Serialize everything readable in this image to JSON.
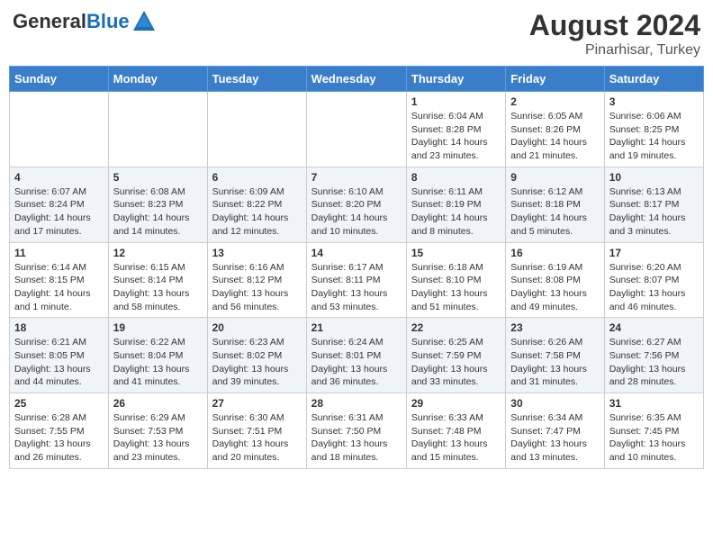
{
  "header": {
    "logo_general": "General",
    "logo_blue": "Blue",
    "month_year": "August 2024",
    "location": "Pinarhisar, Turkey"
  },
  "weekdays": [
    "Sunday",
    "Monday",
    "Tuesday",
    "Wednesday",
    "Thursday",
    "Friday",
    "Saturday"
  ],
  "weeks": [
    [
      {
        "day": "",
        "content": ""
      },
      {
        "day": "",
        "content": ""
      },
      {
        "day": "",
        "content": ""
      },
      {
        "day": "",
        "content": ""
      },
      {
        "day": "1",
        "content": "Sunrise: 6:04 AM\nSunset: 8:28 PM\nDaylight: 14 hours\nand 23 minutes."
      },
      {
        "day": "2",
        "content": "Sunrise: 6:05 AM\nSunset: 8:26 PM\nDaylight: 14 hours\nand 21 minutes."
      },
      {
        "day": "3",
        "content": "Sunrise: 6:06 AM\nSunset: 8:25 PM\nDaylight: 14 hours\nand 19 minutes."
      }
    ],
    [
      {
        "day": "4",
        "content": "Sunrise: 6:07 AM\nSunset: 8:24 PM\nDaylight: 14 hours\nand 17 minutes."
      },
      {
        "day": "5",
        "content": "Sunrise: 6:08 AM\nSunset: 8:23 PM\nDaylight: 14 hours\nand 14 minutes."
      },
      {
        "day": "6",
        "content": "Sunrise: 6:09 AM\nSunset: 8:22 PM\nDaylight: 14 hours\nand 12 minutes."
      },
      {
        "day": "7",
        "content": "Sunrise: 6:10 AM\nSunset: 8:20 PM\nDaylight: 14 hours\nand 10 minutes."
      },
      {
        "day": "8",
        "content": "Sunrise: 6:11 AM\nSunset: 8:19 PM\nDaylight: 14 hours\nand 8 minutes."
      },
      {
        "day": "9",
        "content": "Sunrise: 6:12 AM\nSunset: 8:18 PM\nDaylight: 14 hours\nand 5 minutes."
      },
      {
        "day": "10",
        "content": "Sunrise: 6:13 AM\nSunset: 8:17 PM\nDaylight: 14 hours\nand 3 minutes."
      }
    ],
    [
      {
        "day": "11",
        "content": "Sunrise: 6:14 AM\nSunset: 8:15 PM\nDaylight: 14 hours\nand 1 minute."
      },
      {
        "day": "12",
        "content": "Sunrise: 6:15 AM\nSunset: 8:14 PM\nDaylight: 13 hours\nand 58 minutes."
      },
      {
        "day": "13",
        "content": "Sunrise: 6:16 AM\nSunset: 8:12 PM\nDaylight: 13 hours\nand 56 minutes."
      },
      {
        "day": "14",
        "content": "Sunrise: 6:17 AM\nSunset: 8:11 PM\nDaylight: 13 hours\nand 53 minutes."
      },
      {
        "day": "15",
        "content": "Sunrise: 6:18 AM\nSunset: 8:10 PM\nDaylight: 13 hours\nand 51 minutes."
      },
      {
        "day": "16",
        "content": "Sunrise: 6:19 AM\nSunset: 8:08 PM\nDaylight: 13 hours\nand 49 minutes."
      },
      {
        "day": "17",
        "content": "Sunrise: 6:20 AM\nSunset: 8:07 PM\nDaylight: 13 hours\nand 46 minutes."
      }
    ],
    [
      {
        "day": "18",
        "content": "Sunrise: 6:21 AM\nSunset: 8:05 PM\nDaylight: 13 hours\nand 44 minutes."
      },
      {
        "day": "19",
        "content": "Sunrise: 6:22 AM\nSunset: 8:04 PM\nDaylight: 13 hours\nand 41 minutes."
      },
      {
        "day": "20",
        "content": "Sunrise: 6:23 AM\nSunset: 8:02 PM\nDaylight: 13 hours\nand 39 minutes."
      },
      {
        "day": "21",
        "content": "Sunrise: 6:24 AM\nSunset: 8:01 PM\nDaylight: 13 hours\nand 36 minutes."
      },
      {
        "day": "22",
        "content": "Sunrise: 6:25 AM\nSunset: 7:59 PM\nDaylight: 13 hours\nand 33 minutes."
      },
      {
        "day": "23",
        "content": "Sunrise: 6:26 AM\nSunset: 7:58 PM\nDaylight: 13 hours\nand 31 minutes."
      },
      {
        "day": "24",
        "content": "Sunrise: 6:27 AM\nSunset: 7:56 PM\nDaylight: 13 hours\nand 28 minutes."
      }
    ],
    [
      {
        "day": "25",
        "content": "Sunrise: 6:28 AM\nSunset: 7:55 PM\nDaylight: 13 hours\nand 26 minutes."
      },
      {
        "day": "26",
        "content": "Sunrise: 6:29 AM\nSunset: 7:53 PM\nDaylight: 13 hours\nand 23 minutes."
      },
      {
        "day": "27",
        "content": "Sunrise: 6:30 AM\nSunset: 7:51 PM\nDaylight: 13 hours\nand 20 minutes."
      },
      {
        "day": "28",
        "content": "Sunrise: 6:31 AM\nSunset: 7:50 PM\nDaylight: 13 hours\nand 18 minutes."
      },
      {
        "day": "29",
        "content": "Sunrise: 6:33 AM\nSunset: 7:48 PM\nDaylight: 13 hours\nand 15 minutes."
      },
      {
        "day": "30",
        "content": "Sunrise: 6:34 AM\nSunset: 7:47 PM\nDaylight: 13 hours\nand 13 minutes."
      },
      {
        "day": "31",
        "content": "Sunrise: 6:35 AM\nSunset: 7:45 PM\nDaylight: 13 hours\nand 10 minutes."
      }
    ]
  ]
}
